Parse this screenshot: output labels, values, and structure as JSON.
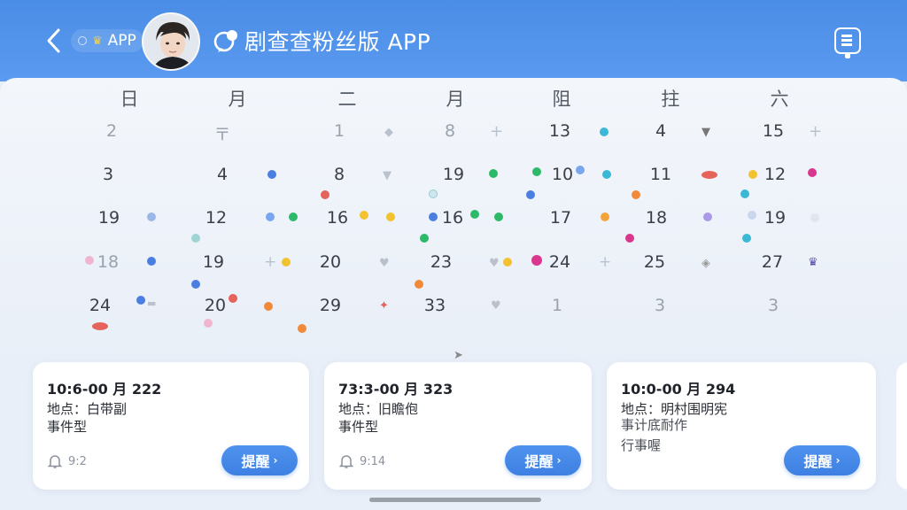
{
  "header": {
    "app_pill": "APP",
    "title": "剧查查粉丝版 APP"
  },
  "calendar": {
    "weekdays": [
      "日",
      "月",
      "二",
      "月",
      "阻",
      "拄",
      "六"
    ],
    "rows": [
      [
        "2",
        "〒",
        "1",
        "8",
        "13",
        "4",
        "15"
      ],
      [
        "3",
        "4",
        "8",
        "19",
        "10",
        "11",
        "12"
      ],
      [
        "19",
        "12",
        "16",
        "16",
        "17",
        "18",
        "19"
      ],
      [
        "18",
        "19",
        "20",
        "23",
        "24",
        "25",
        "27"
      ],
      [
        "24",
        "20",
        "29",
        "33",
        "1",
        "3",
        "3"
      ]
    ]
  },
  "cards": [
    {
      "time": "10:6-00 月 222",
      "location": "地点：白带副",
      "line2": "事件型",
      "line3": "",
      "reminder": "9:2",
      "button": "提醒"
    },
    {
      "time": "73:3-00 月 323",
      "location": "地点：旧瞻佨",
      "line2": "事件型",
      "line3": "",
      "reminder": "9:14",
      "button": "提醒"
    },
    {
      "time": "10:0-00 月 294",
      "location": "地点：明村围明宪",
      "line2": "事计底耐作",
      "line3": "行事喔",
      "reminder": "",
      "button": "提醒"
    }
  ],
  "colors": {
    "header_blue": "#4a8de6",
    "button_blue": "#3d80e2",
    "accent_icons": [
      "back-arrow-icon",
      "menu-icon",
      "bell-icon",
      "chevron-right-icon"
    ]
  }
}
